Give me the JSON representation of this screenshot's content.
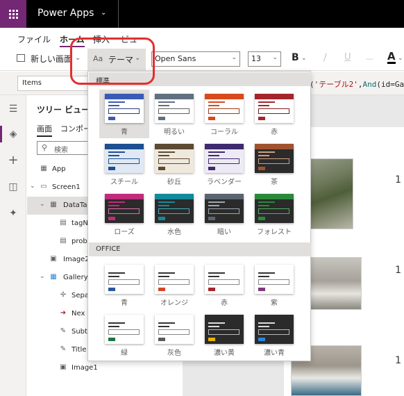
{
  "header": {
    "app_title": "Power Apps"
  },
  "menu": {
    "tabs": [
      {
        "label": "ファイル",
        "active": false
      },
      {
        "label": "ホーム",
        "active": true
      },
      {
        "label": "挿入",
        "active": false
      },
      {
        "label": "ビュー",
        "active": false
      }
    ]
  },
  "toolbar": {
    "new_screen": "新しい画面",
    "theme": "テーマ",
    "font_name": "Open Sans",
    "font_size": "13",
    "bold": "B",
    "italic": "/",
    "underline": "U",
    "strike": "—",
    "font_color": "A"
  },
  "formula": {
    "property": "Items",
    "text_prefix": "(",
    "text_string": "'テーブル2'",
    "text_mid": ",",
    "text_func": "And",
    "text_tail": "(id=Ga"
  },
  "tree": {
    "title": "ツリー ビュー",
    "tabs": [
      "画面",
      "コンポー"
    ],
    "search_placeholder": "検索",
    "rows": [
      {
        "label": "App",
        "icon": "app-icon"
      },
      {
        "label": "Screen1",
        "icon": "screen-icon"
      },
      {
        "label": "DataTab",
        "icon": "table-icon"
      },
      {
        "label": "tagN",
        "icon": "label-icon"
      },
      {
        "label": "prob",
        "icon": "label-icon"
      },
      {
        "label": "Image2",
        "icon": "image-icon"
      },
      {
        "label": "Gallery1",
        "icon": "gallery-icon"
      },
      {
        "label": "Sepa",
        "icon": "separator-icon"
      },
      {
        "label": "Nex",
        "icon": "next-arrow-icon"
      },
      {
        "label": "Subt",
        "icon": "edit-label-icon"
      },
      {
        "label": "Title",
        "icon": "edit-label-icon"
      },
      {
        "label": "Image1",
        "icon": "image-icon"
      }
    ]
  },
  "theme_panel": {
    "standard_header": "標準",
    "office_header": "OFFICE",
    "standard": [
      {
        "name": "青",
        "bar": "#3a5bb5",
        "line": "#3a5bb5",
        "bg": "#ffffff",
        "input": "#2b3f7a",
        "btn": "#3a5bb5",
        "selected": true
      },
      {
        "name": "明るい",
        "bar": "#607080",
        "line": "#607080",
        "bg": "#ffffff",
        "input": "#606060",
        "btn": "#607080",
        "selected": false
      },
      {
        "name": "コーラル",
        "bar": "#d84a1b",
        "line": "#d84a1b",
        "bg": "#ffffff",
        "input": "#a03a18",
        "btn": "#d84a1b",
        "selected": false
      },
      {
        "name": "赤",
        "bar": "#a4262c",
        "line": "#a4262c",
        "bg": "#ffffff",
        "input": "#7a1c20",
        "btn": "#a4262c",
        "selected": false
      },
      {
        "name": "スチール",
        "bar": "#1d4f91",
        "line": "#1d4f91",
        "bg": "#dfe8f3",
        "input": "#1d4f91",
        "btn": "#1d4f91",
        "selected": false
      },
      {
        "name": "砂丘",
        "bar": "#5c4a32",
        "line": "#5c4a32",
        "bg": "#efe8dc",
        "input": "#5c4a32",
        "btn": "#5c4a32",
        "selected": false
      },
      {
        "name": "ラベンダー",
        "bar": "#3e2a70",
        "line": "#3e2a70",
        "bg": "#eeeaf5",
        "input": "#3e2a70",
        "btn": "#3e2a70",
        "selected": false
      },
      {
        "name": "茶",
        "bar": "#a0522d",
        "line": "#d0a080",
        "bg": "#2b2b2b",
        "input": "#d0a080",
        "btn": "#a0522d",
        "selected": false
      },
      {
        "name": "ローズ",
        "bar": "#c22a7c",
        "line": "#c22a7c",
        "bg": "#2b2b2b",
        "input": "#e070b0",
        "btn": "#c22a7c",
        "selected": false
      },
      {
        "name": "水色",
        "bar": "#138a9c",
        "line": "#138a9c",
        "bg": "#2b2b2b",
        "input": "#40b0c0",
        "btn": "#138a9c",
        "selected": false
      },
      {
        "name": "暗い",
        "bar": "#5a6570",
        "line": "#a0a8b0",
        "bg": "#2b2b2b",
        "input": "#a0a8b0",
        "btn": "#5a6570",
        "selected": false
      },
      {
        "name": "フォレスト",
        "bar": "#2a8a3a",
        "line": "#2a8a3a",
        "bg": "#2b2b2b",
        "input": "#50b060",
        "btn": "#2a8a3a",
        "selected": false
      }
    ],
    "office": [
      {
        "name": "青",
        "bar": "#ffffff",
        "line": "#333333",
        "bg": "#ffffff",
        "input": "#888888",
        "btn": "#2b579a",
        "selected": false
      },
      {
        "name": "オレンジ",
        "bar": "#ffffff",
        "line": "#333333",
        "bg": "#ffffff",
        "input": "#888888",
        "btn": "#d24726",
        "selected": false
      },
      {
        "name": "赤",
        "bar": "#ffffff",
        "line": "#333333",
        "bg": "#ffffff",
        "input": "#888888",
        "btn": "#a4262c",
        "selected": false
      },
      {
        "name": "紫",
        "bar": "#ffffff",
        "line": "#333333",
        "bg": "#ffffff",
        "input": "#888888",
        "btn": "#80397b",
        "selected": false
      },
      {
        "name": "緑",
        "bar": "#ffffff",
        "line": "#333333",
        "bg": "#ffffff",
        "input": "#888888",
        "btn": "#217346",
        "selected": false
      },
      {
        "name": "灰色",
        "bar": "#ffffff",
        "line": "#333333",
        "bg": "#ffffff",
        "input": "#888888",
        "btn": "#5a5a5a",
        "selected": false
      },
      {
        "name": "濃い黄",
        "bar": "#2b2b2b",
        "line": "#dddddd",
        "bg": "#2b2b2b",
        "input": "#bbbbbb",
        "btn": "#e8b400",
        "selected": false
      },
      {
        "name": "濃い青",
        "bar": "#2b2b2b",
        "line": "#dddddd",
        "bg": "#2b2b2b",
        "input": "#bbbbbb",
        "btn": "#2b88d8",
        "selected": false
      }
    ]
  },
  "canvas": {
    "row_numbers": [
      "1",
      "1",
      "1"
    ]
  }
}
